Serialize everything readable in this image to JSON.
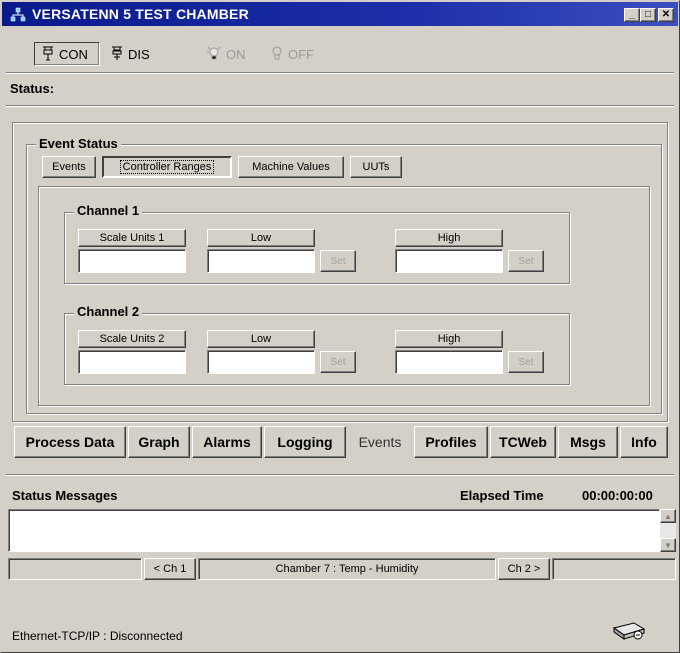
{
  "window": {
    "title": "VERSATENN 5 TEST CHAMBER",
    "controls": [
      "_",
      "□",
      "✕"
    ]
  },
  "toolbar": {
    "con_label": "CON",
    "dis_label": "DIS",
    "on_label": "ON",
    "off_label": "OFF"
  },
  "status_label": "Status:",
  "event_status": {
    "title": "Event Status",
    "tabs": [
      "Events",
      "Controller Ranges",
      "Machine Values",
      "UUTs"
    ],
    "active_tab": "Controller Ranges"
  },
  "channels": [
    {
      "title": "Channel 1",
      "scale_label": "Scale Units 1",
      "low_label": "Low",
      "high_label": "High",
      "set_label": "Set",
      "scale_value": "",
      "low_value": "",
      "high_value": ""
    },
    {
      "title": "Channel 2",
      "scale_label": "Scale Units 2",
      "low_label": "Low",
      "high_label": "High",
      "set_label": "Set",
      "scale_value": "",
      "low_value": "",
      "high_value": ""
    }
  ],
  "bottom_tabs": [
    "Process Data",
    "Graph",
    "Alarms",
    "Logging",
    "Events",
    "Profiles",
    "TCWeb",
    "Msgs",
    "Info"
  ],
  "selected_bottom_tab": "Events",
  "status_messages": {
    "title": "Status Messages",
    "elapsed_label": "Elapsed Time",
    "elapsed_value": "00:00:00:00",
    "content": ""
  },
  "chamber_nav": {
    "prev_label": "< Ch 1",
    "chamber_text": "Chamber 7 : Temp - Humidity",
    "next_label": "Ch 2 >"
  },
  "connection_status": "Ethernet-TCP/IP : Disconnected",
  "icons": {
    "app": "network-icon",
    "con": "plug-connect-icon",
    "dis": "plug-disconnect-icon",
    "on": "lamp-on-icon",
    "off": "lamp-off-icon",
    "connection": "modem-icon"
  },
  "colors": {
    "titlebar": "#0a1a8c",
    "face": "#d4d0c8",
    "disabled_text": "#9a9a9a"
  }
}
